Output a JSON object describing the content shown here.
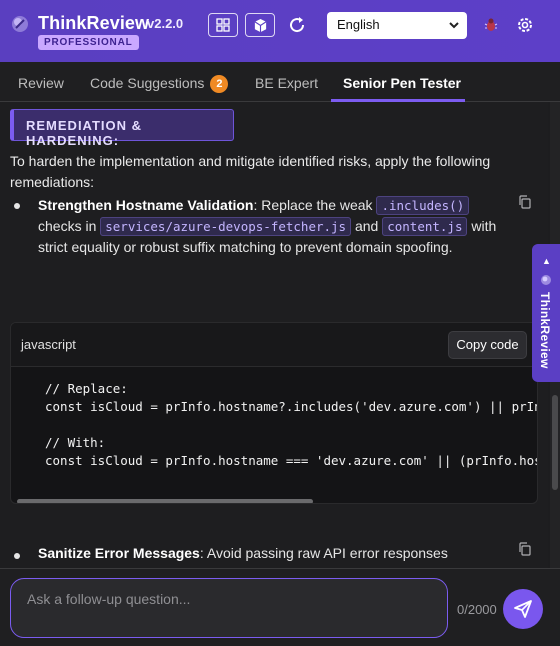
{
  "header": {
    "brand": "ThinkReview",
    "badge": "PROFESSIONAL",
    "version": "v2.2.0",
    "language": "English"
  },
  "tabs": [
    {
      "label": "Review"
    },
    {
      "label": "Code Suggestions",
      "count": "2"
    },
    {
      "label": "BE Expert"
    },
    {
      "label": "Senior Pen Tester"
    }
  ],
  "content": {
    "section_heading": "REMEDIATION & HARDENING:",
    "intro": "To harden the implementation and mitigate identified risks, apply the following remediations:",
    "item1": {
      "title": "Strengthen Hostname Validation",
      "t1": ": Replace the weak ",
      "code1": ".includes()",
      "t2": " checks in ",
      "code2": "services/azure-devops-fetcher.js",
      "t3": " and ",
      "code3": "content.js",
      "t4": " with strict equality or robust suffix matching to prevent domain spoofing."
    },
    "code_block": {
      "language": "javascript",
      "copy_label": "Copy code",
      "lines": [
        "// Replace:",
        "const isCloud = prInfo.hostname?.includes('dev.azure.com') || prInfo",
        "",
        "// With:",
        "const isCloud = prInfo.hostname === 'dev.azure.com' || (prInfo.hostn"
      ]
    },
    "item2": {
      "title": "Sanitize Error Messages",
      "text": ": Avoid passing raw API error responses"
    }
  },
  "side_tab": {
    "label": "ThinkReview"
  },
  "footer": {
    "placeholder": "Ask a follow-up question...",
    "char_count": "0/2000"
  },
  "colors": {
    "brand": "#5b3fc4",
    "accent": "#7c5cf0",
    "badge": "#f08a24"
  }
}
